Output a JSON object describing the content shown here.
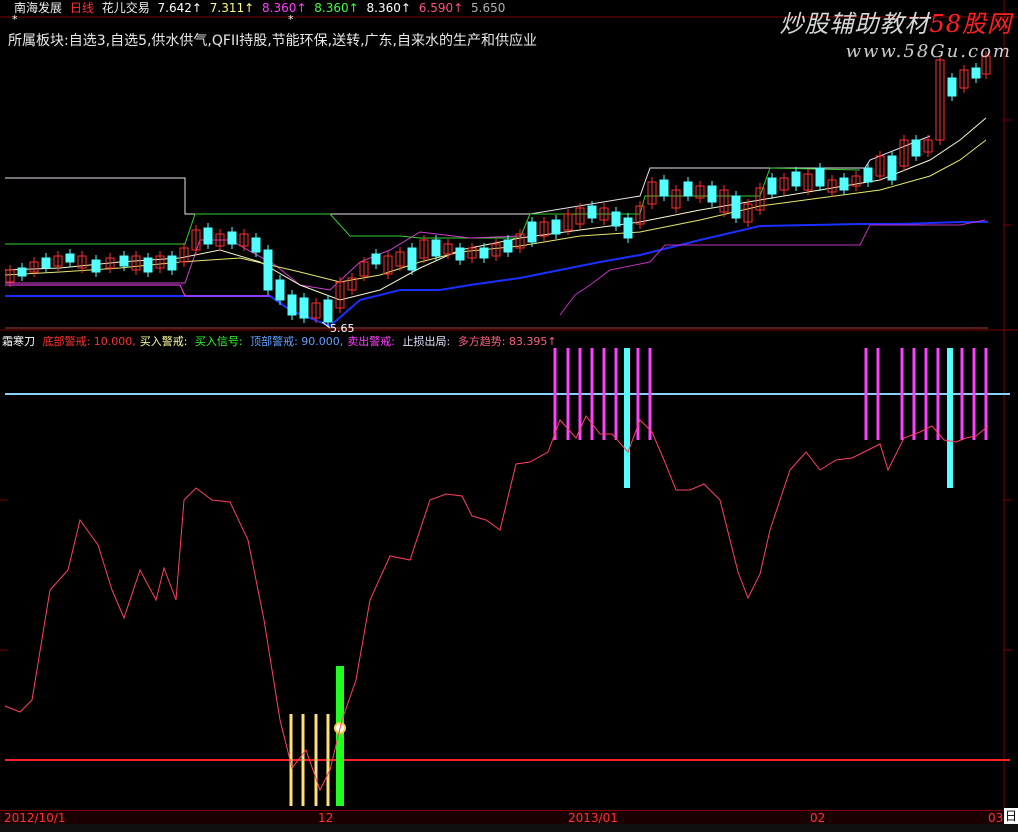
{
  "header": {
    "stock_name": "南海发展",
    "period": "日线",
    "indicator_name": "花儿交易",
    "v1": "7.642↑",
    "v2": "7.311↑",
    "v3": "8.360↑",
    "v4": "8.360↑",
    "v5": "8.360↑",
    "v6": "6.590↑",
    "v7": "5.650",
    "stars": [
      "*",
      "*"
    ]
  },
  "sector": {
    "text": "所属板块:自选3,自选5,供水供气,QFII持股,节能环保,送转,广东,自来水的生产和供应业"
  },
  "watermark": {
    "line1_a": "炒股辅助教材",
    "line1_b": "58股网",
    "line2": "www.58Gu.com"
  },
  "price_low_label": "5.65",
  "indicator": {
    "name": "霜寒刀",
    "items": [
      {
        "label": "底部警戒:",
        "value": "10.000,",
        "color": "#ff3030"
      },
      {
        "label": "买入警戒:",
        "value": "",
        "color": "#ffffa0"
      },
      {
        "label": "买入信号:",
        "value": "",
        "color": "#30ff30"
      },
      {
        "label": "顶部警戒:",
        "value": "90.000,",
        "color": "#60a0ff"
      },
      {
        "label": "卖出警戒:",
        "value": "",
        "color": "#ff40ff"
      },
      {
        "label": "止损出局:",
        "value": "",
        "color": "#e0e0ff"
      },
      {
        "label": "多方趋势:",
        "value": "83.395↑",
        "color": "#ff6080"
      }
    ]
  },
  "dates": [
    {
      "label": "2012/10/1"
    },
    {
      "label": "12"
    },
    {
      "label": "2013/01"
    },
    {
      "label": "02"
    },
    {
      "label": "03"
    }
  ],
  "corner_label": "日",
  "colors": {
    "up": "#ff3030",
    "down": "#54ffff",
    "grid": "#800000",
    "top_line": "#87d0ff",
    "bottom_line": "#ff2020",
    "trend": "#ff4060",
    "sell": "#ff40ff",
    "buy_warn": "#ffe070",
    "buy": "#20ff20"
  }
}
